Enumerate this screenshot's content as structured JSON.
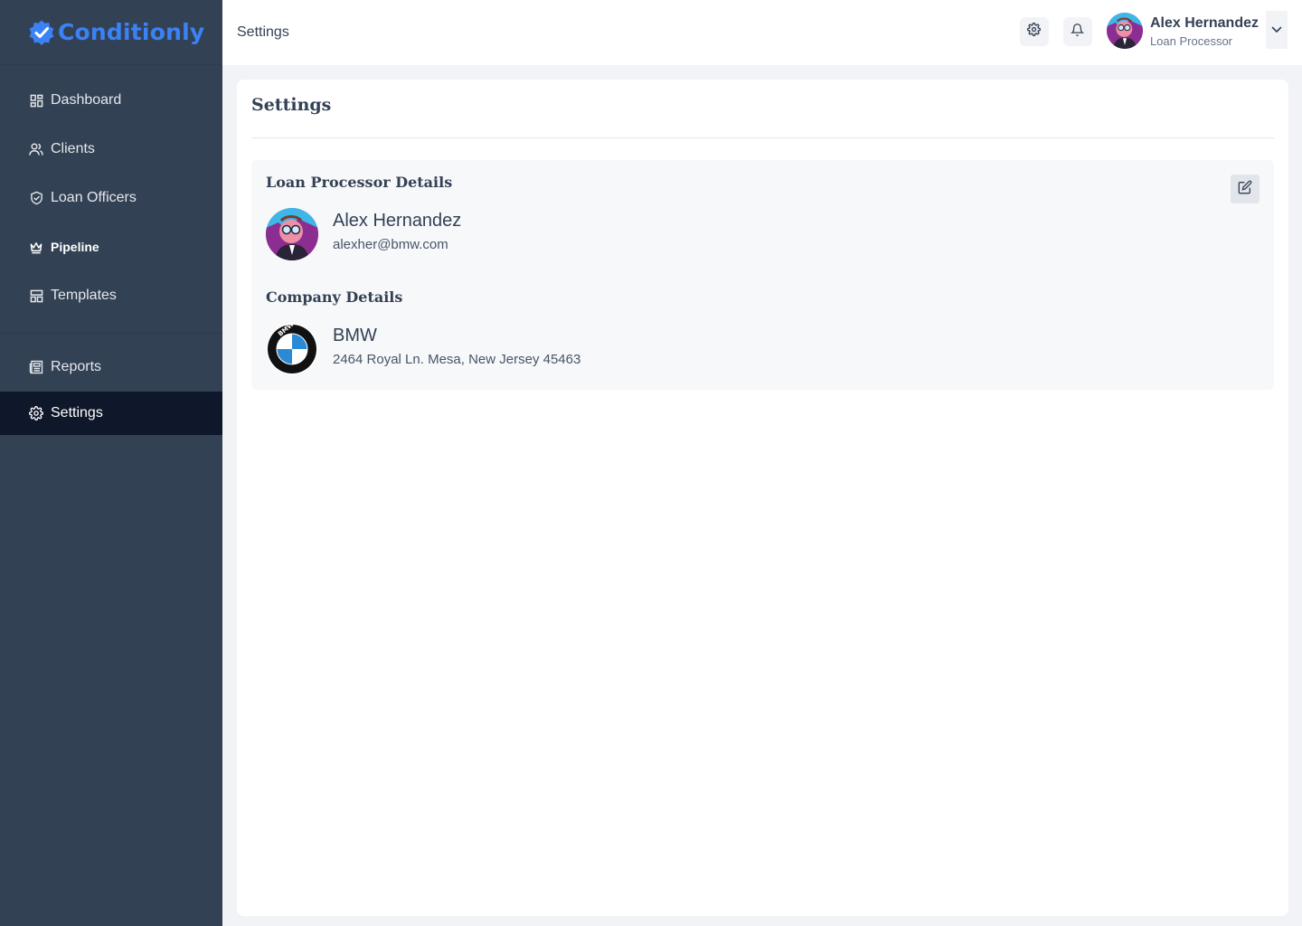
{
  "app": {
    "name": "Conditionly",
    "brand_color": "#3b82f6"
  },
  "sidebar": {
    "items": [
      {
        "label": "Dashboard",
        "icon": "dashboard-icon"
      },
      {
        "label": "Clients",
        "icon": "users-icon"
      },
      {
        "label": "Loan Officers",
        "icon": "shield-check-icon"
      },
      {
        "label": "Pipeline",
        "icon": "crown-icon"
      },
      {
        "label": "Templates",
        "icon": "templates-icon"
      },
      {
        "label": "Reports",
        "icon": "reports-icon"
      },
      {
        "label": "Settings",
        "icon": "gear-icon",
        "active": true
      }
    ]
  },
  "header": {
    "title": "Settings",
    "user": {
      "name": "Alex Hernandez",
      "role": "Loan Processor"
    }
  },
  "main": {
    "title": "Settings",
    "processor": {
      "section_title": "Loan Processor Details",
      "name": "Alex Hernandez",
      "email": "alexher@bmw.com"
    },
    "company": {
      "section_title": "Company Details",
      "name": "BMW",
      "address": "2464 Royal Ln. Mesa, New Jersey 45463",
      "logo_letters": "BMW"
    }
  }
}
